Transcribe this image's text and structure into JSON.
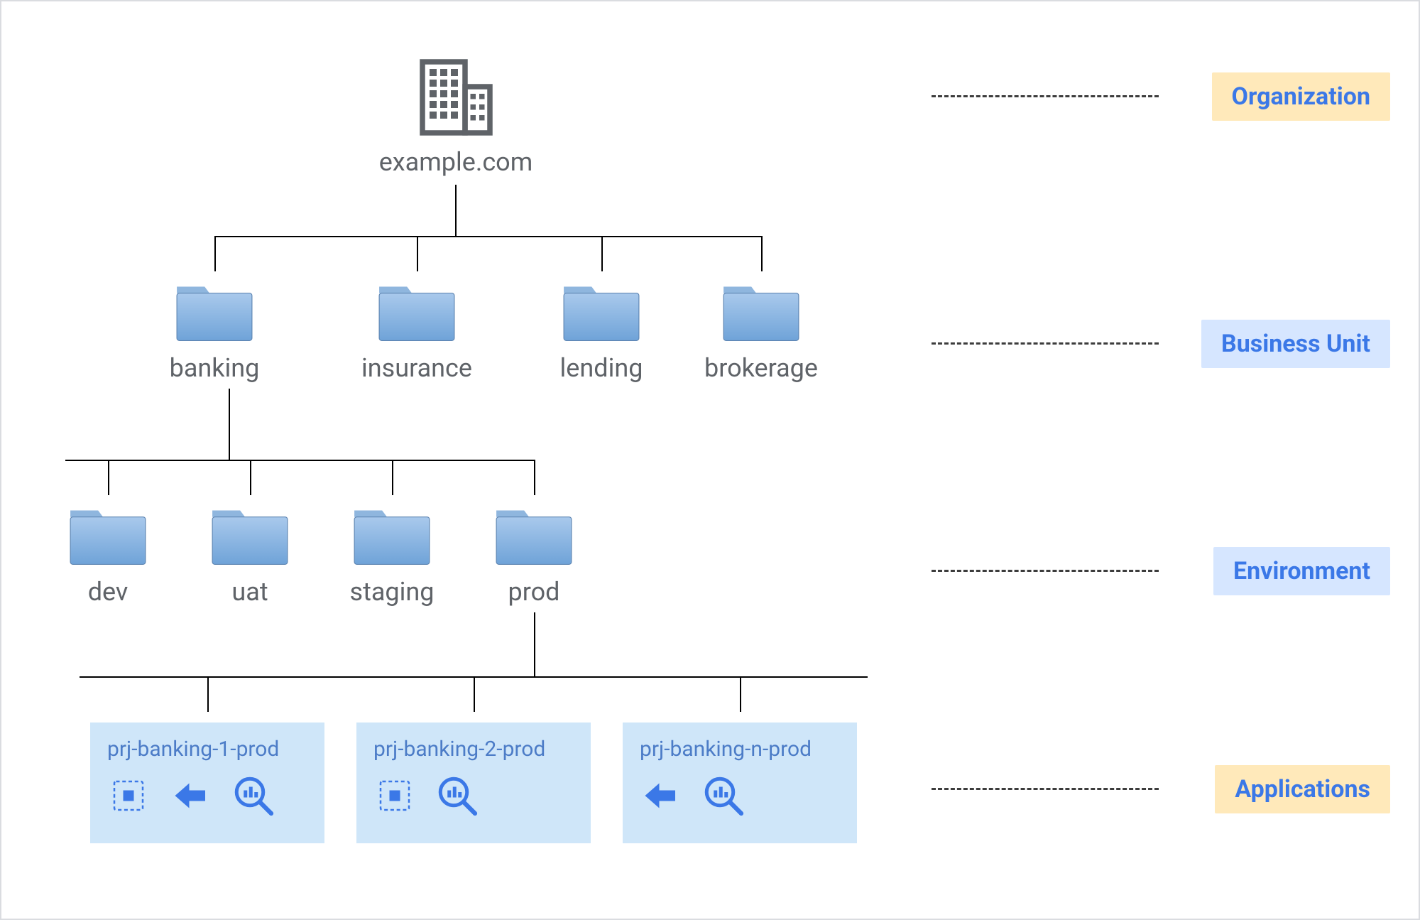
{
  "legend": {
    "organization": "Organization",
    "business_unit": "Business Unit",
    "environment": "Environment",
    "applications": "Applications"
  },
  "org": {
    "label": "example.com"
  },
  "business_units": [
    {
      "label": "banking"
    },
    {
      "label": "insurance"
    },
    {
      "label": "lending"
    },
    {
      "label": "brokerage"
    }
  ],
  "environments": [
    {
      "label": "dev"
    },
    {
      "label": "uat"
    },
    {
      "label": "staging"
    },
    {
      "label": "prod"
    }
  ],
  "projects": [
    {
      "label": "prj-banking-1-prod"
    },
    {
      "label": "prj-banking-2-prod"
    },
    {
      "label": "prj-banking-n-prod"
    }
  ]
}
